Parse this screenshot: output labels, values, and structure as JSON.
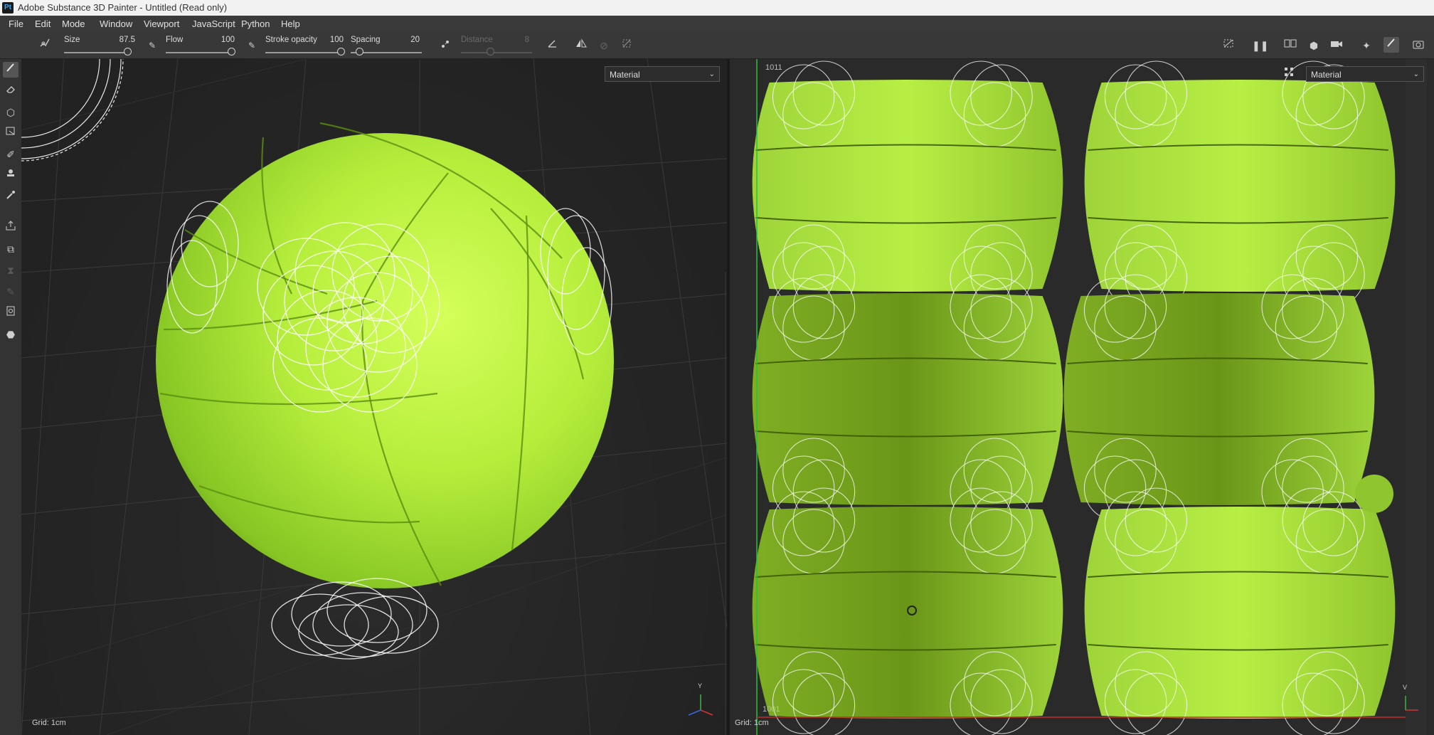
{
  "app": {
    "icon_text": "Pt",
    "title": "Adobe Substance 3D Painter - Untitled (Read only)"
  },
  "menu": [
    "File",
    "Edit",
    "Mode",
    "Window",
    "Viewport",
    "JavaScript",
    "Python",
    "Help"
  ],
  "tool_options": {
    "size": {
      "label": "Size",
      "value": "87.5"
    },
    "flow": {
      "label": "Flow",
      "value": "100"
    },
    "stroke_opacity": {
      "label": "Stroke opacity",
      "value": "100"
    },
    "spacing": {
      "label": "Spacing",
      "value": "20"
    },
    "distance": {
      "label": "Distance",
      "value": "8"
    }
  },
  "viewport3d": {
    "channel_select": "Material",
    "grid_label": "Grid: 1cm",
    "axis_label": "Y"
  },
  "viewport2d": {
    "channel_select": "Material",
    "grid_label": "Grid: 1cm",
    "udim_top": "1011",
    "udim_bottom": "1001",
    "axis_label": "V"
  },
  "colors": {
    "ball_green": "#b6ee3c",
    "ball_shadow": "#5c8a12",
    "ui_bg": "#262626",
    "guide_line": "#27c13a",
    "uv_border": "#c12a2a"
  },
  "icons": {
    "left_tools": [
      "paint-brush-icon",
      "eraser-icon",
      "projection-icon",
      "polygon-fill-icon",
      "smudge-icon",
      "clone-stamp-icon",
      "color-picker-icon",
      "export-icon",
      "bake-icon",
      "history-icon",
      "geometry-mask-icon",
      "illustration-icon",
      "shelf-icon"
    ]
  }
}
